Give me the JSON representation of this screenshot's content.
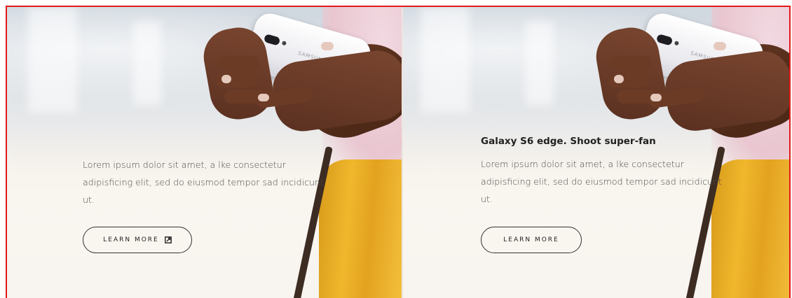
{
  "panels": [
    {
      "title": "",
      "description": "Lorem ipsum dolor sit amet, a lke consectetur adipisficing elit, sed do eiusmod tempor sad incidicunt ut.",
      "button_label": "LEARN MORE",
      "button_icon": "external-link-icon"
    },
    {
      "title": "Galaxy S6 edge. Shoot super-fan",
      "description": "Lorem ipsum dolor sit amet, a lke consectetur adipisficing elit, sed do eiusmod tempor sad incidicunt ut.",
      "button_label": "LEARN MORE"
    }
  ],
  "phone_brand": "SAMSUNG",
  "colors": {
    "frame_border": "#e01a1a",
    "button_border": "#333333",
    "skirt": "#f0b72c"
  }
}
